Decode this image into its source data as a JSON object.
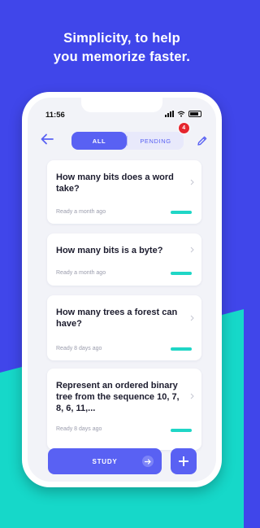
{
  "headline": {
    "line1": "Simplicity, to help",
    "line2": "you memorize faster."
  },
  "status_bar": {
    "time": "11:56"
  },
  "nav": {
    "back_icon": "arrow-left-icon",
    "edit_icon": "pencil-icon",
    "tabs": [
      {
        "label": "ALL",
        "selected": true
      },
      {
        "label": "PENDING",
        "selected": false,
        "badge": "4"
      }
    ]
  },
  "cards": [
    {
      "question": "How many bits does a word take?",
      "meta": "Ready a month ago"
    },
    {
      "question": "How many bits is a byte?",
      "meta": "Ready a month ago"
    },
    {
      "question": "How many trees a forest can have?",
      "meta": "Ready 8 days ago"
    },
    {
      "question": "Represent an ordered binary tree from the sequence 10, 7, 8, 6, 11,...",
      "meta": "Ready 8 days ago"
    }
  ],
  "actions": {
    "study_label": "STUDY",
    "add_icon": "plus-icon"
  },
  "colors": {
    "background": "#4046ea",
    "wave": "#16d8c9",
    "accent": "#5961f3",
    "progress": "#1fd6c6",
    "badge": "#e5262e"
  }
}
